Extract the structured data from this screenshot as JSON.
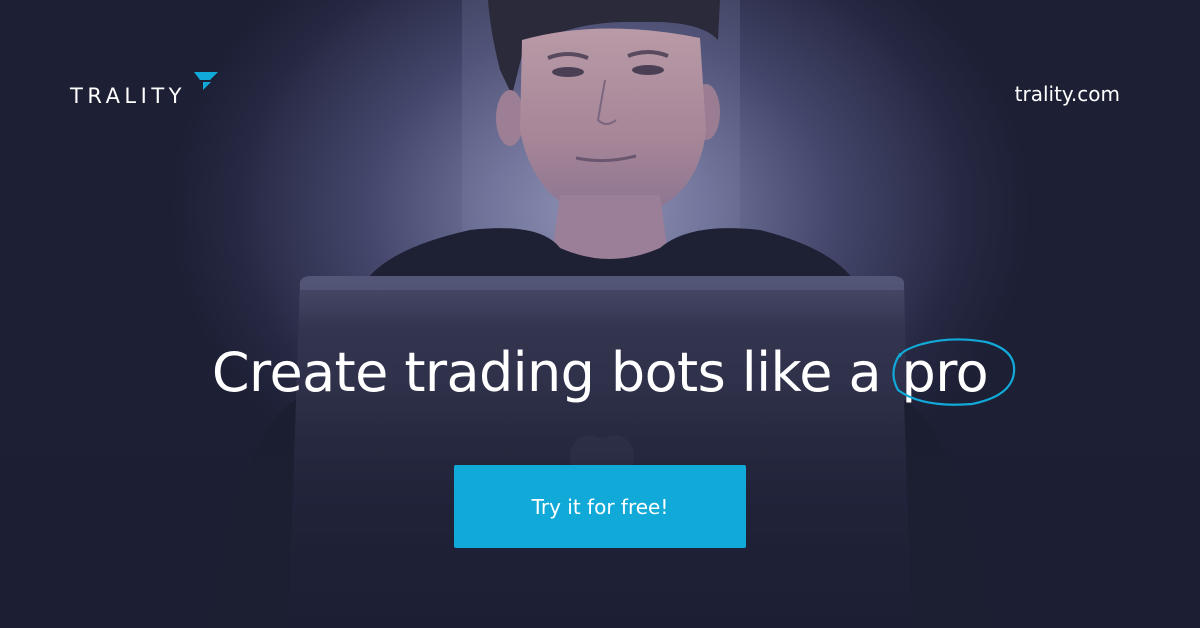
{
  "brand": {
    "name": "TRALITY",
    "logo_icon": "trality-arrow-mark-icon",
    "accent_color": "#11a9d8"
  },
  "header": {
    "site_url": "trality.com"
  },
  "hero": {
    "headline_main": "Create trading bots like a",
    "headline_highlight": "pro",
    "highlight_decoration": "hand-drawn-circle-icon",
    "background": "person-with-laptop-photo"
  },
  "cta": {
    "label": "Try it for free!",
    "color": "#11a9d8"
  }
}
